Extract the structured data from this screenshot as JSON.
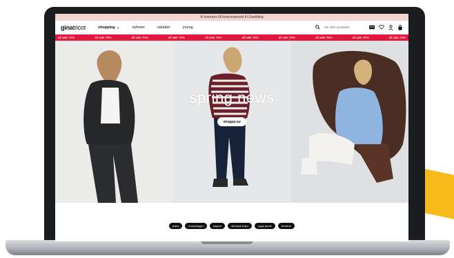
{
  "announcement": {
    "text": "fri leverans till leveranspunkt fri Gambling"
  },
  "header": {
    "logo_bold": "gina",
    "logo_thin": "tricot",
    "nav_items": [
      {
        "label": "shopping",
        "active": true
      },
      {
        "label": "nyheter"
      },
      {
        "label": "rabatter"
      },
      {
        "label": "young"
      }
    ],
    "search_placeholder": "sök efter produkter"
  },
  "sale_ticker": {
    "items": [
      "all sale 70%",
      "all sale 70%",
      "all sale 70%",
      "all sale 70%",
      "all sale 70%",
      "all sale 70%",
      "all sale 70%",
      "all sale 70%",
      "all sale 70%",
      "all sale 70%"
    ]
  },
  "hero": {
    "title": "spring news",
    "cta": "shoppa nu"
  },
  "categories": [
    "jeans",
    "kostymtyger",
    "kappor",
    "stickade tröjor",
    "yoga pants",
    "linnetrar"
  ],
  "colors": {
    "announcement_bg": "#f3d4cf",
    "sale_bg": "#e3163f",
    "accent_stripe": "#f7b81a"
  }
}
